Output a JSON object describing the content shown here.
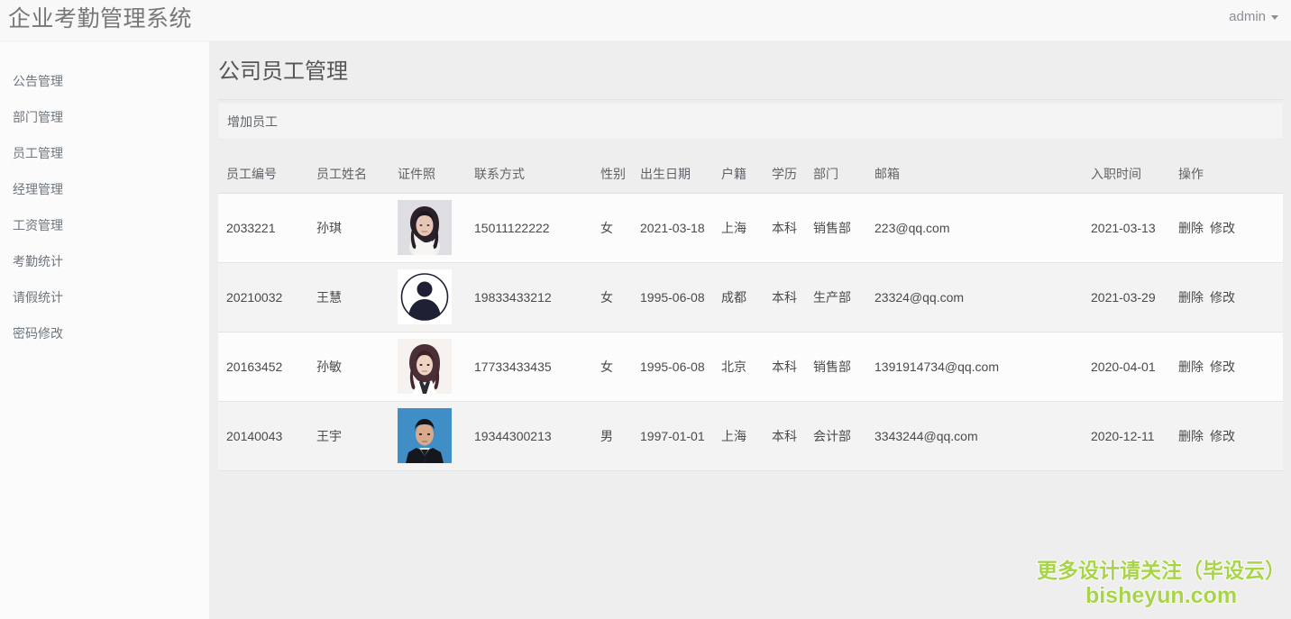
{
  "app": {
    "brand": "企业考勤管理系统",
    "user": "admin"
  },
  "sidebar": {
    "items": [
      {
        "label": "公告管理",
        "key": "notice"
      },
      {
        "label": "部门管理",
        "key": "department"
      },
      {
        "label": "员工管理",
        "key": "employee"
      },
      {
        "label": "经理管理",
        "key": "manager"
      },
      {
        "label": "工资管理",
        "key": "salary"
      },
      {
        "label": "考勤统计",
        "key": "attendance-stats"
      },
      {
        "label": "请假统计",
        "key": "leave-stats"
      },
      {
        "label": "密码修改",
        "key": "change-password"
      }
    ]
  },
  "page": {
    "title": "公司员工管理",
    "toolbar": {
      "add_employee": "增加员工"
    }
  },
  "table": {
    "columns": [
      {
        "key": "id",
        "label": "员工编号"
      },
      {
        "key": "name",
        "label": "员工姓名"
      },
      {
        "key": "photo",
        "label": "证件照"
      },
      {
        "key": "phone",
        "label": "联系方式"
      },
      {
        "key": "sex",
        "label": "性别"
      },
      {
        "key": "birth",
        "label": "出生日期"
      },
      {
        "key": "home",
        "label": "户籍"
      },
      {
        "key": "edu",
        "label": "学历"
      },
      {
        "key": "dept",
        "label": "部门"
      },
      {
        "key": "mail",
        "label": "邮箱"
      },
      {
        "key": "hire",
        "label": "入职时间"
      },
      {
        "key": "ops",
        "label": "操作"
      }
    ],
    "ops": {
      "delete": "删除",
      "edit": "修改"
    },
    "rows": [
      {
        "id": "2033221",
        "name": "孙琪",
        "photo": "portrait-female-gray-backdrop",
        "phone": "15011122222",
        "sex": "女",
        "birth": "2021-03-18",
        "home": "上海",
        "edu": "本科",
        "dept": "销售部",
        "mail": "223@qq.com",
        "hire": "2021-03-13"
      },
      {
        "id": "20210032",
        "name": "王慧",
        "photo": "default-avatar-placeholder",
        "phone": "19833433212",
        "sex": "女",
        "birth": "1995-06-08",
        "home": "成都",
        "edu": "本科",
        "dept": "生产部",
        "mail": "23324@qq.com",
        "hire": "2021-03-29"
      },
      {
        "id": "20163452",
        "name": "孙敏",
        "photo": "portrait-female-white-backdrop",
        "phone": "17733433435",
        "sex": "女",
        "birth": "1995-06-08",
        "home": "北京",
        "edu": "本科",
        "dept": "销售部",
        "mail": "1391914734@qq.com",
        "hire": "2020-04-01"
      },
      {
        "id": "20140043",
        "name": "王宇",
        "photo": "portrait-male-blue-backdrop",
        "phone": "19344300213",
        "sex": "男",
        "birth": "1997-01-01",
        "home": "上海",
        "edu": "本科",
        "dept": "会计部",
        "mail": "3343244@qq.com",
        "hire": "2020-12-11"
      }
    ]
  },
  "watermark": {
    "line1": "更多设计请关注（毕设云）",
    "line2": "bisheyun.com",
    "color": "#a8d44a"
  },
  "colors": {
    "page_bg": "#eeeeee",
    "sidebar_bg": "#fbfbfb",
    "row_odd": "#fcfcfc",
    "row_even": "#f3f3f3",
    "text": "#4a4a4a",
    "muted": "#6f767d"
  }
}
